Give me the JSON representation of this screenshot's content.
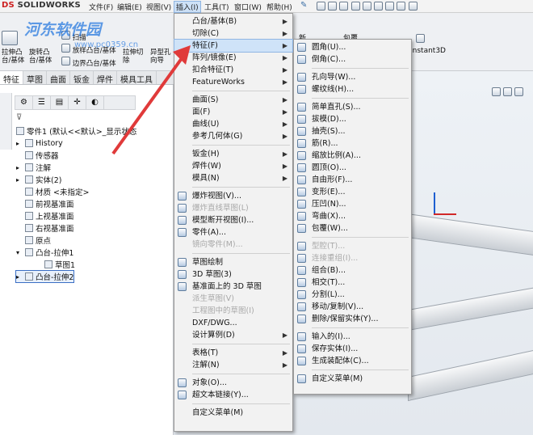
{
  "app": {
    "logo": "SOLIDWORKS",
    "logo_prefix": "DS"
  },
  "menubar": {
    "items": [
      "文件(F)",
      "编辑(E)",
      "视图(V)",
      "插入(I)",
      "工具(T)",
      "窗口(W)",
      "帮助(H)"
    ],
    "active_index": 3
  },
  "ribbon": {
    "buttons": [
      "拉伸凸台/基体",
      "旋转凸台/基体",
      "扫描",
      "放样凸台/基体",
      "边界凸台/基体",
      "拉伸切除",
      "异型孔向导"
    ],
    "right_labels": [
      "新",
      "包覆",
      "Instant3D"
    ]
  },
  "watermark": {
    "text": "河东软件园",
    "url": "www.pc0359.cn"
  },
  "tabs": [
    "特征",
    "草图",
    "曲面",
    "钣金",
    "焊件",
    "模具工具"
  ],
  "tree": {
    "root": "零件1 (默认<<默认>_显示状态",
    "items": [
      {
        "label": "History",
        "level": 1,
        "expand": "▸"
      },
      {
        "label": "传感器",
        "level": 1,
        "expand": ""
      },
      {
        "label": "注解",
        "level": 1,
        "expand": "▸"
      },
      {
        "label": "实体(2)",
        "level": 1,
        "expand": "▸"
      },
      {
        "label": "材质 <未指定>",
        "level": 1,
        "expand": ""
      },
      {
        "label": "前视基准面",
        "level": 1,
        "expand": ""
      },
      {
        "label": "上视基准面",
        "level": 1,
        "expand": ""
      },
      {
        "label": "右视基准面",
        "level": 1,
        "expand": ""
      },
      {
        "label": "原点",
        "level": 1,
        "expand": ""
      },
      {
        "label": "凸台-拉伸1",
        "level": 1,
        "expand": "▾"
      },
      {
        "label": "草图1",
        "level": 2,
        "expand": ""
      },
      {
        "label": "凸台-拉伸2",
        "level": 1,
        "expand": "▸",
        "selected": true
      }
    ]
  },
  "insert_menu": {
    "items": [
      {
        "label": "凸台/基体(B)",
        "arrow": true
      },
      {
        "label": "切除(C)",
        "arrow": true
      },
      {
        "label": "特征(F)",
        "arrow": true,
        "highlight": true
      },
      {
        "label": "阵列/镜像(E)",
        "arrow": true
      },
      {
        "label": "扣合特征(T)",
        "arrow": true
      },
      {
        "label": "FeatureWorks",
        "arrow": true
      },
      {
        "sep": true
      },
      {
        "label": "曲面(S)",
        "arrow": true
      },
      {
        "label": "面(F)",
        "arrow": true
      },
      {
        "label": "曲线(U)",
        "arrow": true
      },
      {
        "label": "参考几何体(G)",
        "arrow": true
      },
      {
        "sep": true
      },
      {
        "label": "钣金(H)",
        "arrow": true
      },
      {
        "label": "焊件(W)",
        "arrow": true
      },
      {
        "label": "模具(N)",
        "arrow": true
      },
      {
        "sep": true
      },
      {
        "label": "爆炸视图(V)...",
        "icon": true
      },
      {
        "label": "爆炸直线草图(L)",
        "disabled": true,
        "icon": true
      },
      {
        "label": "模型断开视图(I)...",
        "icon": true
      },
      {
        "label": "零件(A)...",
        "icon": true
      },
      {
        "label": "镜向零件(M)...",
        "disabled": true
      },
      {
        "sep": true
      },
      {
        "label": "草图绘制",
        "icon": true
      },
      {
        "label": "3D 草图(3)",
        "icon": true
      },
      {
        "label": "基准面上的 3D 草图",
        "icon": true
      },
      {
        "label": "派生草图(V)",
        "disabled": true
      },
      {
        "label": "工程图中的草图(I)",
        "disabled": true
      },
      {
        "label": "DXF/DWG..."
      },
      {
        "label": "设计算例(D)",
        "arrow": true
      },
      {
        "sep": true
      },
      {
        "label": "表格(T)",
        "arrow": true
      },
      {
        "label": "注解(N)",
        "arrow": true
      },
      {
        "sep": true
      },
      {
        "label": "对象(O)...",
        "icon": true
      },
      {
        "label": "超文本链接(Y)...",
        "icon": true
      },
      {
        "sep": true
      },
      {
        "label": "自定义菜单(M)"
      }
    ]
  },
  "feature_menu": {
    "items": [
      {
        "label": "圆角(U)..."
      },
      {
        "label": "倒角(C)..."
      },
      {
        "sep": true
      },
      {
        "label": "孔向导(W)..."
      },
      {
        "label": "螺纹线(H)..."
      },
      {
        "sep": true
      },
      {
        "label": "简单直孔(S)..."
      },
      {
        "label": "拔模(D)..."
      },
      {
        "label": "抽壳(S)..."
      },
      {
        "label": "筋(R)..."
      },
      {
        "label": "缩放比例(A)..."
      },
      {
        "label": "圆顶(O)..."
      },
      {
        "label": "自由形(F)..."
      },
      {
        "label": "变形(E)..."
      },
      {
        "label": "压凹(N)..."
      },
      {
        "label": "弯曲(X)..."
      },
      {
        "label": "包覆(W)..."
      },
      {
        "sep": true
      },
      {
        "label": "型腔(T)...",
        "disabled": true
      },
      {
        "label": "连接重组(I)...",
        "disabled": true
      },
      {
        "label": "组合(B)..."
      },
      {
        "label": "相交(T)..."
      },
      {
        "label": "分割(L)..."
      },
      {
        "label": "移动/复制(V)..."
      },
      {
        "label": "删除/保留实体(Y)..."
      },
      {
        "sep": true
      },
      {
        "label": "输入的(I)..."
      },
      {
        "label": "保存实体(I)..."
      },
      {
        "label": "生成装配体(C)..."
      },
      {
        "sep": true
      },
      {
        "label": "自定义菜单(M)"
      }
    ]
  },
  "colors": {
    "accent": "#cfe3f8",
    "arrow": "#e03a3a",
    "watermark": "#2a7be0"
  }
}
